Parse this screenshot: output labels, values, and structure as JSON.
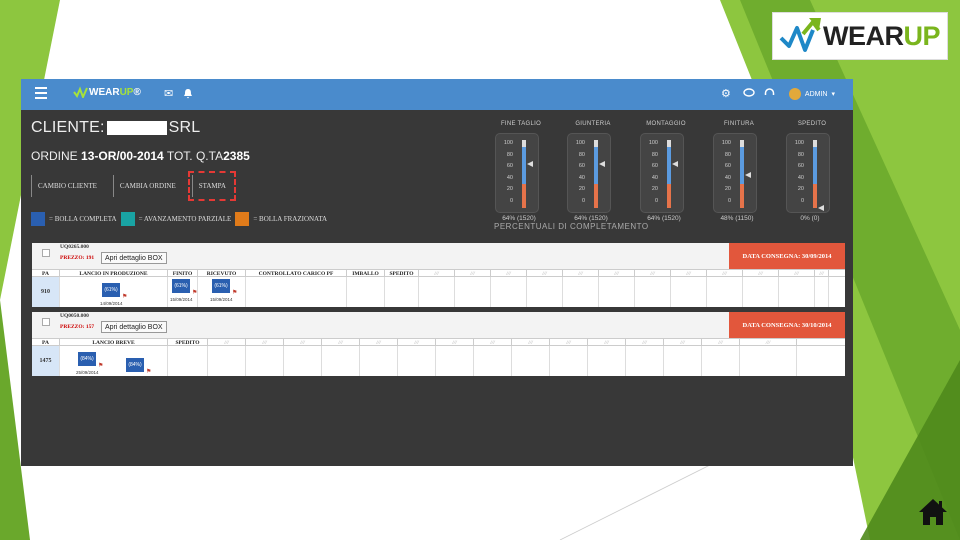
{
  "logo": {
    "text_a": "WEAR",
    "text_b": "UP"
  },
  "app": {
    "logo_a": "WEAR",
    "logo_b": "UP",
    "logo_suffix": "®",
    "user": "ADMIN",
    "caret": "▾"
  },
  "header": {
    "cliente_label": "CLIENTE:",
    "cliente_suffix": "SRL",
    "ordine_label": "ORDINE",
    "ordine_code": "13-OR/00-2014",
    "qta_label": "TOT. Q.TA",
    "qta_value": "2385"
  },
  "buttons": {
    "cambio_cliente": "CAMBIO CLIENTE",
    "cambia_ordine": "CAMBIA ORDINE",
    "stampa": "STAMPA"
  },
  "legend": {
    "completa": "= BOLLA COMPLETA",
    "parziale": "= AVANZAMENTO PARZIALE",
    "frazionata": "= BOLLA FRAZIONATA",
    "colors": {
      "completa": "#2a5fb0",
      "parziale": "#19a3a3",
      "frazionata": "#e07b1a"
    }
  },
  "gauges": [
    {
      "title": "FINE TAGLIO",
      "value": "64% (1520)",
      "percent": 64
    },
    {
      "title": "GIUNTERIA",
      "value": "64% (1520)",
      "percent": 64
    },
    {
      "title": "MONTAGGIO",
      "value": "64% (1520)",
      "percent": 64
    },
    {
      "title": "FINITURA",
      "value": "48% (1150)",
      "percent": 48
    },
    {
      "title": "SPEDITO",
      "value": "0% (0)",
      "percent": 0
    }
  ],
  "gauge_scale": [
    "100",
    "80",
    "60",
    "40",
    "20",
    "0"
  ],
  "percentuali_label": "PERCENTUALI DI COMPLETAMENTO",
  "cards": [
    {
      "title": "UQ0265.000",
      "prezzo": "PREZZO: 191",
      "apri": "Apri dettaglio BOX",
      "consegna": "DATA CONSEGNA: 30/09/2014",
      "columns": [
        "PA",
        "LANCIO IN PRODUZIONE",
        "FINITO",
        "RICEVUTO",
        "CONTROLLATO CARICO PF",
        "IMBALLO",
        "SPEDITO",
        "///",
        "///",
        "///",
        "///",
        "///",
        "///",
        "///",
        "///",
        "///",
        "///",
        "///",
        "///"
      ],
      "pa_value": "910",
      "stages": [
        {
          "label": "(61%)",
          "date": "14/09/2014"
        },
        {
          "label": "(61%)",
          "date": "15/09/2014"
        },
        {
          "label": "(61%)",
          "date": "15/09/2014"
        }
      ]
    },
    {
      "title": "UQ0050.000",
      "prezzo": "PREZZO: 157",
      "apri": "Apri dettaglio BOX",
      "consegna": "DATA CONSEGNA: 30/10/2014",
      "columns": [
        "PA",
        "LANCIO BREVE",
        "SPEDITO",
        "///",
        "///",
        "///",
        "///",
        "///",
        "///",
        "///",
        "///",
        "///",
        "///",
        "///",
        "///",
        "///",
        "///",
        "///"
      ],
      "pa_value": "1475",
      "stages": [
        {
          "label": "(84%)",
          "date": "25/09/2014"
        },
        {
          "label": "(84%)",
          "date": "26/09/2014"
        }
      ]
    }
  ]
}
